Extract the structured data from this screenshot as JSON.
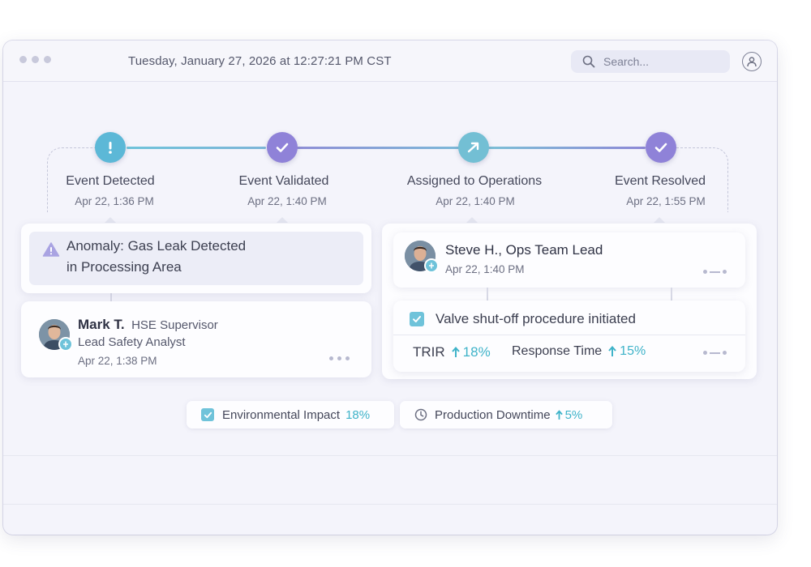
{
  "header": {
    "datetime": "Tuesday, January 27, 2026 at 12:27:21 PM CST",
    "search_placeholder": "Search...",
    "icons": [
      "window-dots",
      "search-icon",
      "user-icon"
    ]
  },
  "timeline": {
    "steps": [
      {
        "label": "Event Detected",
        "time": "Apr 22, 1:36 PM",
        "icon": "alert-icon",
        "color": "#5cb8d7"
      },
      {
        "label": "Event Validated",
        "time": "Apr 22, 1:40 PM",
        "icon": "check-icon",
        "color": "#8f82d8"
      },
      {
        "label": "Assigned to Operations",
        "time": "Apr 22, 1:40 PM",
        "icon": "arrow-icon",
        "color": "#73bfd4"
      },
      {
        "label": "Event Resolved",
        "time": "Apr 22, 1:55 PM",
        "icon": "check-icon",
        "color": "#8f82d8"
      }
    ]
  },
  "anomaly": {
    "line1": "Anomaly: Gas Leak Detected",
    "line2": "in Processing Area",
    "icon": "warning-icon"
  },
  "mark": {
    "name": "Mark T.",
    "title": "HSE Supervisor",
    "role": "Lead Safety Analyst",
    "time": "Apr 22, 1:38 PM"
  },
  "steve": {
    "name": "Steve H., Ops Team Lead",
    "time": "Apr 22, 1:40 PM"
  },
  "action": {
    "label": "Valve shut-off procedure initiated",
    "checked": true
  },
  "metrics": {
    "trir_label": "TRIR",
    "trir_value": "18%",
    "response_label": "Response Time",
    "response_value": "15%"
  },
  "chips": {
    "env_label": "Environmental Impact",
    "env_value": "18%",
    "downtime_label": "Production Downtime",
    "downtime_value": "5%"
  },
  "colors": {
    "accent_teal": "#6fc3da",
    "accent_purple": "#8f82d8",
    "up_value": "#3fb3c9"
  }
}
